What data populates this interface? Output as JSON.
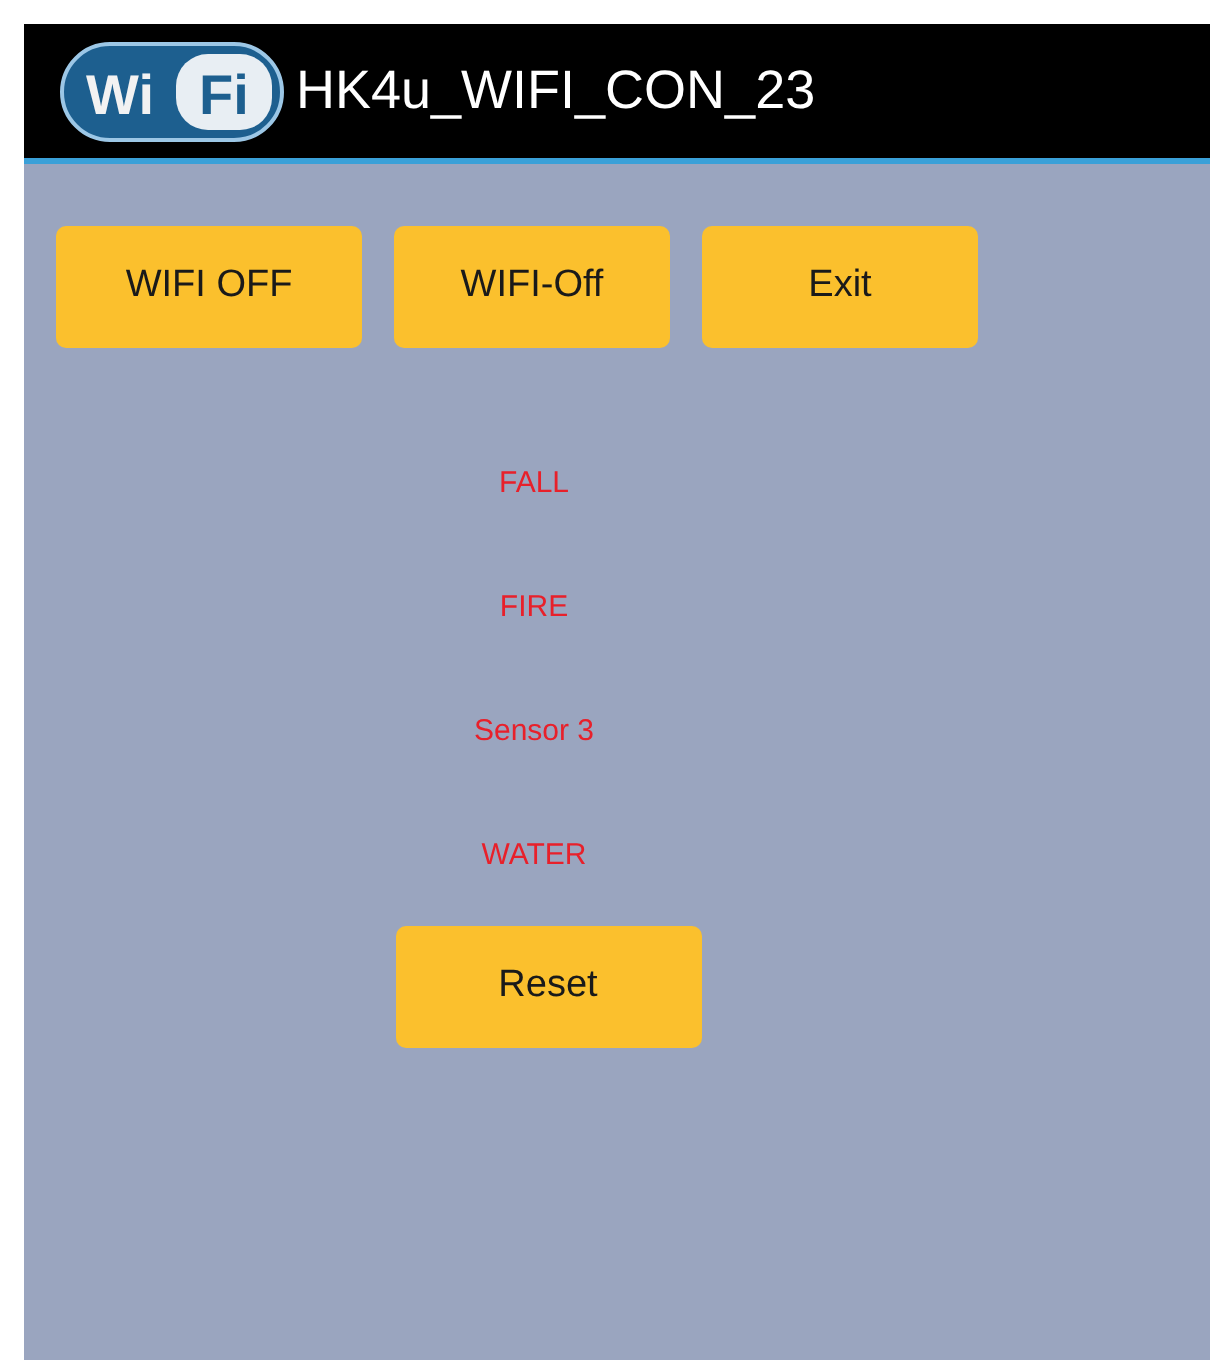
{
  "app_bar": {
    "logo": [
      "Wi",
      "Fi"
    ],
    "title": "HK4u_WIFI_CON_23"
  },
  "buttons": [
    "WIFI OFF",
    "WIFI-Off",
    "Exit"
  ],
  "alerts": [
    "FALL",
    "FIRE",
    "Sensor 3",
    "WATER"
  ],
  "reset_button": "Reset"
}
